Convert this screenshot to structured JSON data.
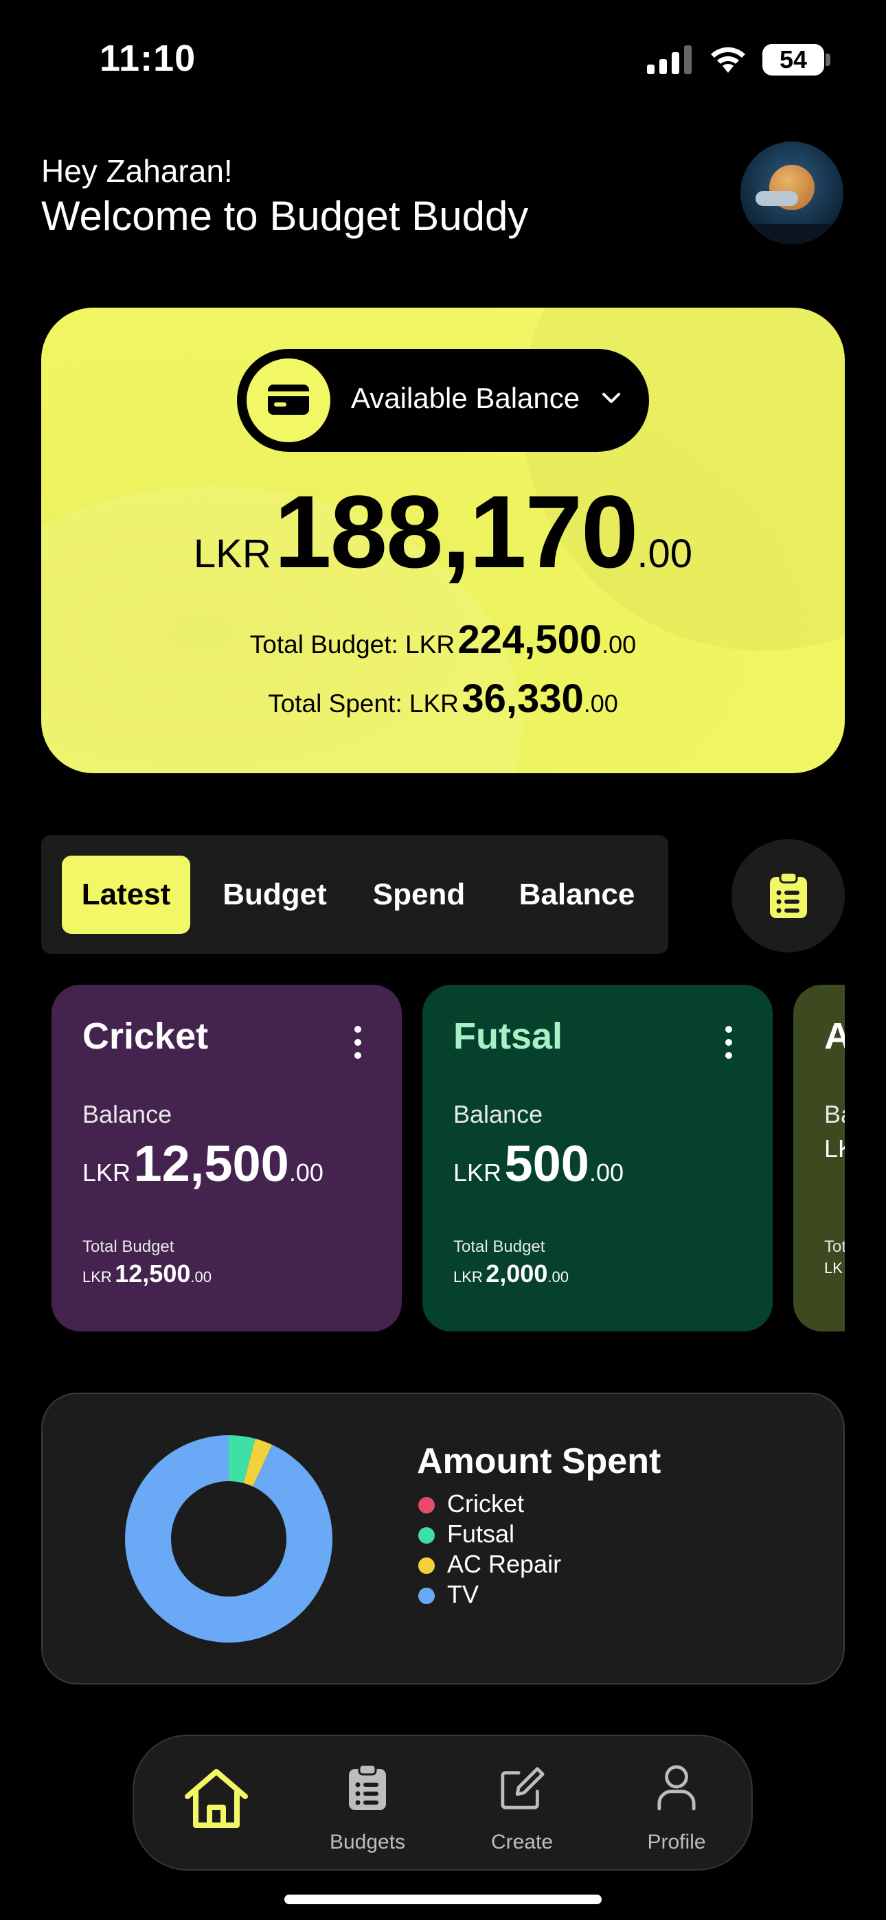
{
  "status_bar": {
    "time": "11:10",
    "battery": "54"
  },
  "header": {
    "greeting": "Hey Zaharan!",
    "welcome": "Welcome to Budget Buddy",
    "avatar_icon": "profile-avatar"
  },
  "balance_card": {
    "selector_label": "Available Balance",
    "currency": "LKR",
    "amount": "188,170",
    "decimals": ".00",
    "total_budget_label": "Total Budget: LKR",
    "total_budget_amount": "224,500",
    "total_budget_decimals": ".00",
    "total_spent_label": "Total Spent: LKR",
    "total_spent_amount": "36,330",
    "total_spent_decimals": ".00",
    "accent_color": "#f2f766"
  },
  "tabs": [
    {
      "label": "Latest",
      "active": true
    },
    {
      "label": "Budget",
      "active": false
    },
    {
      "label": "Spend",
      "active": false
    },
    {
      "label": "Balance",
      "active": false
    }
  ],
  "budget_cards": [
    {
      "title": "Cricket",
      "balance_label": "Balance",
      "currency": "LKR",
      "balance": "12,500",
      "balance_dec": ".00",
      "total_label": "Total Budget",
      "total": "12,500",
      "total_dec": ".00",
      "bg": "#45234f",
      "title_color": "#ffffff"
    },
    {
      "title": "Futsal",
      "balance_label": "Balance",
      "currency": "LKR",
      "balance": "500",
      "balance_dec": ".00",
      "total_label": "Total Budget",
      "total": "2,000",
      "total_dec": ".00",
      "bg": "#06412c",
      "title_color": "#a8f0c8"
    },
    {
      "title": "A",
      "balance_label": "Ba",
      "currency": "LK",
      "balance": "",
      "balance_dec": "",
      "total_label": "Tot",
      "total": "",
      "total_dec": "",
      "cur_small": "LK",
      "bg": "#3d4a1f",
      "title_color": "#ffffff"
    }
  ],
  "amount_spent": {
    "title": "Amount Spent",
    "legend": [
      {
        "label": "Cricket",
        "color": "#e84a6a"
      },
      {
        "label": "Futsal",
        "color": "#3fe0a6"
      },
      {
        "label": "AC Repair",
        "color": "#f2d13c"
      },
      {
        "label": "TV",
        "color": "#6aa9f5"
      }
    ]
  },
  "chart_data": {
    "type": "pie",
    "title": "Amount Spent",
    "categories": [
      "Cricket",
      "Futsal",
      "AC Repair",
      "TV"
    ],
    "values": [
      0,
      1500,
      1000,
      33830
    ],
    "colors": [
      "#e84a6a",
      "#3fe0a6",
      "#f2d13c",
      "#6aa9f5"
    ],
    "donut": true
  },
  "bottom_nav": [
    {
      "label": "",
      "icon": "home-icon",
      "active": true
    },
    {
      "label": "Budgets",
      "icon": "clipboard-icon",
      "active": false
    },
    {
      "label": "Create",
      "icon": "edit-icon",
      "active": false
    },
    {
      "label": "Profile",
      "icon": "user-icon",
      "active": false
    }
  ]
}
